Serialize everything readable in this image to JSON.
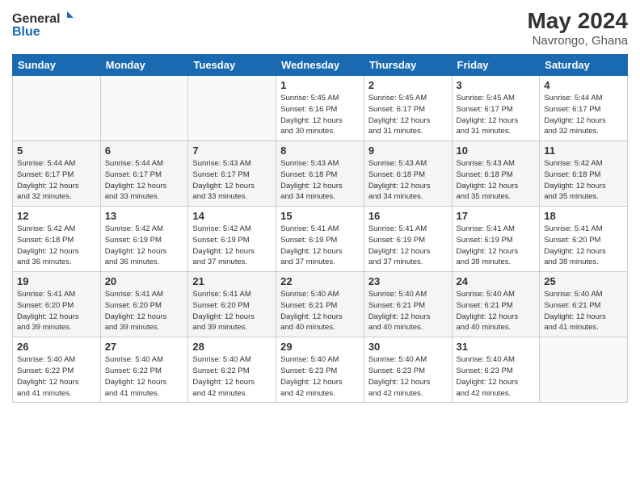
{
  "logo": {
    "text_general": "General",
    "text_blue": "Blue"
  },
  "title": {
    "main": "May 2024",
    "sub": "Navrongo, Ghana"
  },
  "headers": [
    "Sunday",
    "Monday",
    "Tuesday",
    "Wednesday",
    "Thursday",
    "Friday",
    "Saturday"
  ],
  "weeks": [
    [
      {
        "day": "",
        "info": ""
      },
      {
        "day": "",
        "info": ""
      },
      {
        "day": "",
        "info": ""
      },
      {
        "day": "1",
        "info": "Sunrise: 5:45 AM\nSunset: 6:16 PM\nDaylight: 12 hours\nand 30 minutes."
      },
      {
        "day": "2",
        "info": "Sunrise: 5:45 AM\nSunset: 6:17 PM\nDaylight: 12 hours\nand 31 minutes."
      },
      {
        "day": "3",
        "info": "Sunrise: 5:45 AM\nSunset: 6:17 PM\nDaylight: 12 hours\nand 31 minutes."
      },
      {
        "day": "4",
        "info": "Sunrise: 5:44 AM\nSunset: 6:17 PM\nDaylight: 12 hours\nand 32 minutes."
      }
    ],
    [
      {
        "day": "5",
        "info": "Sunrise: 5:44 AM\nSunset: 6:17 PM\nDaylight: 12 hours\nand 32 minutes."
      },
      {
        "day": "6",
        "info": "Sunrise: 5:44 AM\nSunset: 6:17 PM\nDaylight: 12 hours\nand 33 minutes."
      },
      {
        "day": "7",
        "info": "Sunrise: 5:43 AM\nSunset: 6:17 PM\nDaylight: 12 hours\nand 33 minutes."
      },
      {
        "day": "8",
        "info": "Sunrise: 5:43 AM\nSunset: 6:18 PM\nDaylight: 12 hours\nand 34 minutes."
      },
      {
        "day": "9",
        "info": "Sunrise: 5:43 AM\nSunset: 6:18 PM\nDaylight: 12 hours\nand 34 minutes."
      },
      {
        "day": "10",
        "info": "Sunrise: 5:43 AM\nSunset: 6:18 PM\nDaylight: 12 hours\nand 35 minutes."
      },
      {
        "day": "11",
        "info": "Sunrise: 5:42 AM\nSunset: 6:18 PM\nDaylight: 12 hours\nand 35 minutes."
      }
    ],
    [
      {
        "day": "12",
        "info": "Sunrise: 5:42 AM\nSunset: 6:18 PM\nDaylight: 12 hours\nand 36 minutes."
      },
      {
        "day": "13",
        "info": "Sunrise: 5:42 AM\nSunset: 6:19 PM\nDaylight: 12 hours\nand 36 minutes."
      },
      {
        "day": "14",
        "info": "Sunrise: 5:42 AM\nSunset: 6:19 PM\nDaylight: 12 hours\nand 37 minutes."
      },
      {
        "day": "15",
        "info": "Sunrise: 5:41 AM\nSunset: 6:19 PM\nDaylight: 12 hours\nand 37 minutes."
      },
      {
        "day": "16",
        "info": "Sunrise: 5:41 AM\nSunset: 6:19 PM\nDaylight: 12 hours\nand 37 minutes."
      },
      {
        "day": "17",
        "info": "Sunrise: 5:41 AM\nSunset: 6:19 PM\nDaylight: 12 hours\nand 38 minutes."
      },
      {
        "day": "18",
        "info": "Sunrise: 5:41 AM\nSunset: 6:20 PM\nDaylight: 12 hours\nand 38 minutes."
      }
    ],
    [
      {
        "day": "19",
        "info": "Sunrise: 5:41 AM\nSunset: 6:20 PM\nDaylight: 12 hours\nand 39 minutes."
      },
      {
        "day": "20",
        "info": "Sunrise: 5:41 AM\nSunset: 6:20 PM\nDaylight: 12 hours\nand 39 minutes."
      },
      {
        "day": "21",
        "info": "Sunrise: 5:41 AM\nSunset: 6:20 PM\nDaylight: 12 hours\nand 39 minutes."
      },
      {
        "day": "22",
        "info": "Sunrise: 5:40 AM\nSunset: 6:21 PM\nDaylight: 12 hours\nand 40 minutes."
      },
      {
        "day": "23",
        "info": "Sunrise: 5:40 AM\nSunset: 6:21 PM\nDaylight: 12 hours\nand 40 minutes."
      },
      {
        "day": "24",
        "info": "Sunrise: 5:40 AM\nSunset: 6:21 PM\nDaylight: 12 hours\nand 40 minutes."
      },
      {
        "day": "25",
        "info": "Sunrise: 5:40 AM\nSunset: 6:21 PM\nDaylight: 12 hours\nand 41 minutes."
      }
    ],
    [
      {
        "day": "26",
        "info": "Sunrise: 5:40 AM\nSunset: 6:22 PM\nDaylight: 12 hours\nand 41 minutes."
      },
      {
        "day": "27",
        "info": "Sunrise: 5:40 AM\nSunset: 6:22 PM\nDaylight: 12 hours\nand 41 minutes."
      },
      {
        "day": "28",
        "info": "Sunrise: 5:40 AM\nSunset: 6:22 PM\nDaylight: 12 hours\nand 42 minutes."
      },
      {
        "day": "29",
        "info": "Sunrise: 5:40 AM\nSunset: 6:23 PM\nDaylight: 12 hours\nand 42 minutes."
      },
      {
        "day": "30",
        "info": "Sunrise: 5:40 AM\nSunset: 6:23 PM\nDaylight: 12 hours\nand 42 minutes."
      },
      {
        "day": "31",
        "info": "Sunrise: 5:40 AM\nSunset: 6:23 PM\nDaylight: 12 hours\nand 42 minutes."
      },
      {
        "day": "",
        "info": ""
      }
    ]
  ]
}
